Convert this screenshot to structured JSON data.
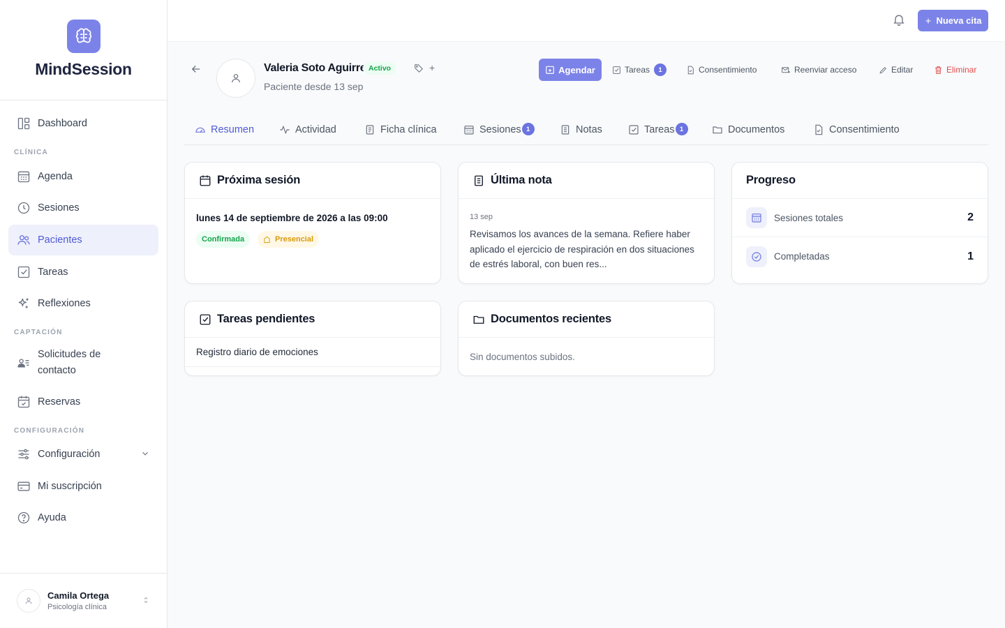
{
  "brand": {
    "name": "MindSession",
    "accent": "#7c83e8"
  },
  "sidebar": {
    "items": [
      {
        "label": "Dashboard",
        "icon": "dashboard-icon"
      },
      {
        "label": "Agenda",
        "icon": "calendar-icon"
      },
      {
        "label": "Sesiones",
        "icon": "clock-icon"
      },
      {
        "label": "Pacientes",
        "icon": "users-icon",
        "active": true
      },
      {
        "label": "Tareas",
        "icon": "checkbox-icon"
      },
      {
        "label": "Reflexiones",
        "icon": "sparkles-icon"
      },
      {
        "label": "Solicitudes de contacto",
        "icon": "contact-list-icon"
      },
      {
        "label": "Reservas",
        "icon": "calendar-check-icon"
      },
      {
        "label": "Configuración",
        "icon": "sliders-icon"
      },
      {
        "label": "Mi suscripción",
        "icon": "credit-card-icon"
      },
      {
        "label": "Ayuda",
        "icon": "help-icon"
      }
    ],
    "sections": {
      "clinica": "CLÍNICA",
      "captacion": "CAPTACIÓN",
      "configuracion": "CONFIGURACIÓN"
    },
    "user": {
      "name": "Camila Ortega",
      "role": "Psicología clínica"
    }
  },
  "topbar": {
    "new_button": "Nueva cita"
  },
  "patient": {
    "name": "Valeria Soto Aguirre",
    "status": "Activo",
    "tag_add": "+",
    "since": "Paciente desde 13 sep"
  },
  "header_actions": {
    "agendar": "Agendar",
    "tareas": "Tareas",
    "tareas_count": "1",
    "consentimiento": "Consentimiento",
    "reenviar": "Reenviar acceso",
    "editar": "Editar",
    "eliminar": "Eliminar"
  },
  "tabs": [
    {
      "label": "Resumen",
      "active": true
    },
    {
      "label": "Actividad"
    },
    {
      "label": "Ficha clínica"
    },
    {
      "label": "Sesiones",
      "badge": "1"
    },
    {
      "label": "Notas"
    },
    {
      "label": "Tareas",
      "badge": "1"
    },
    {
      "label": "Documentos"
    },
    {
      "label": "Consentimiento"
    }
  ],
  "cards": {
    "next_session": {
      "title": "Próxima sesión",
      "date": "lunes 14 de septiembre de 2026 a las 09:00",
      "status": "Confirmada",
      "mode": "Presencial"
    },
    "last_note": {
      "title": "Última nota",
      "date": "13 sep",
      "text": "Revisamos los avances de la semana. Refiere haber aplicado el ejercicio de respiración en dos situaciones de estrés laboral, con buen res..."
    },
    "progress": {
      "title": "Progreso",
      "rows": [
        {
          "label": "Sesiones totales",
          "value": "2"
        },
        {
          "label": "Completadas",
          "value": "1"
        }
      ]
    },
    "pending_tasks": {
      "title": "Tareas pendientes",
      "items": [
        "Registro diario de emociones"
      ]
    },
    "recent_docs": {
      "title": "Documentos recientes",
      "empty": "Sin documentos subidos."
    }
  }
}
